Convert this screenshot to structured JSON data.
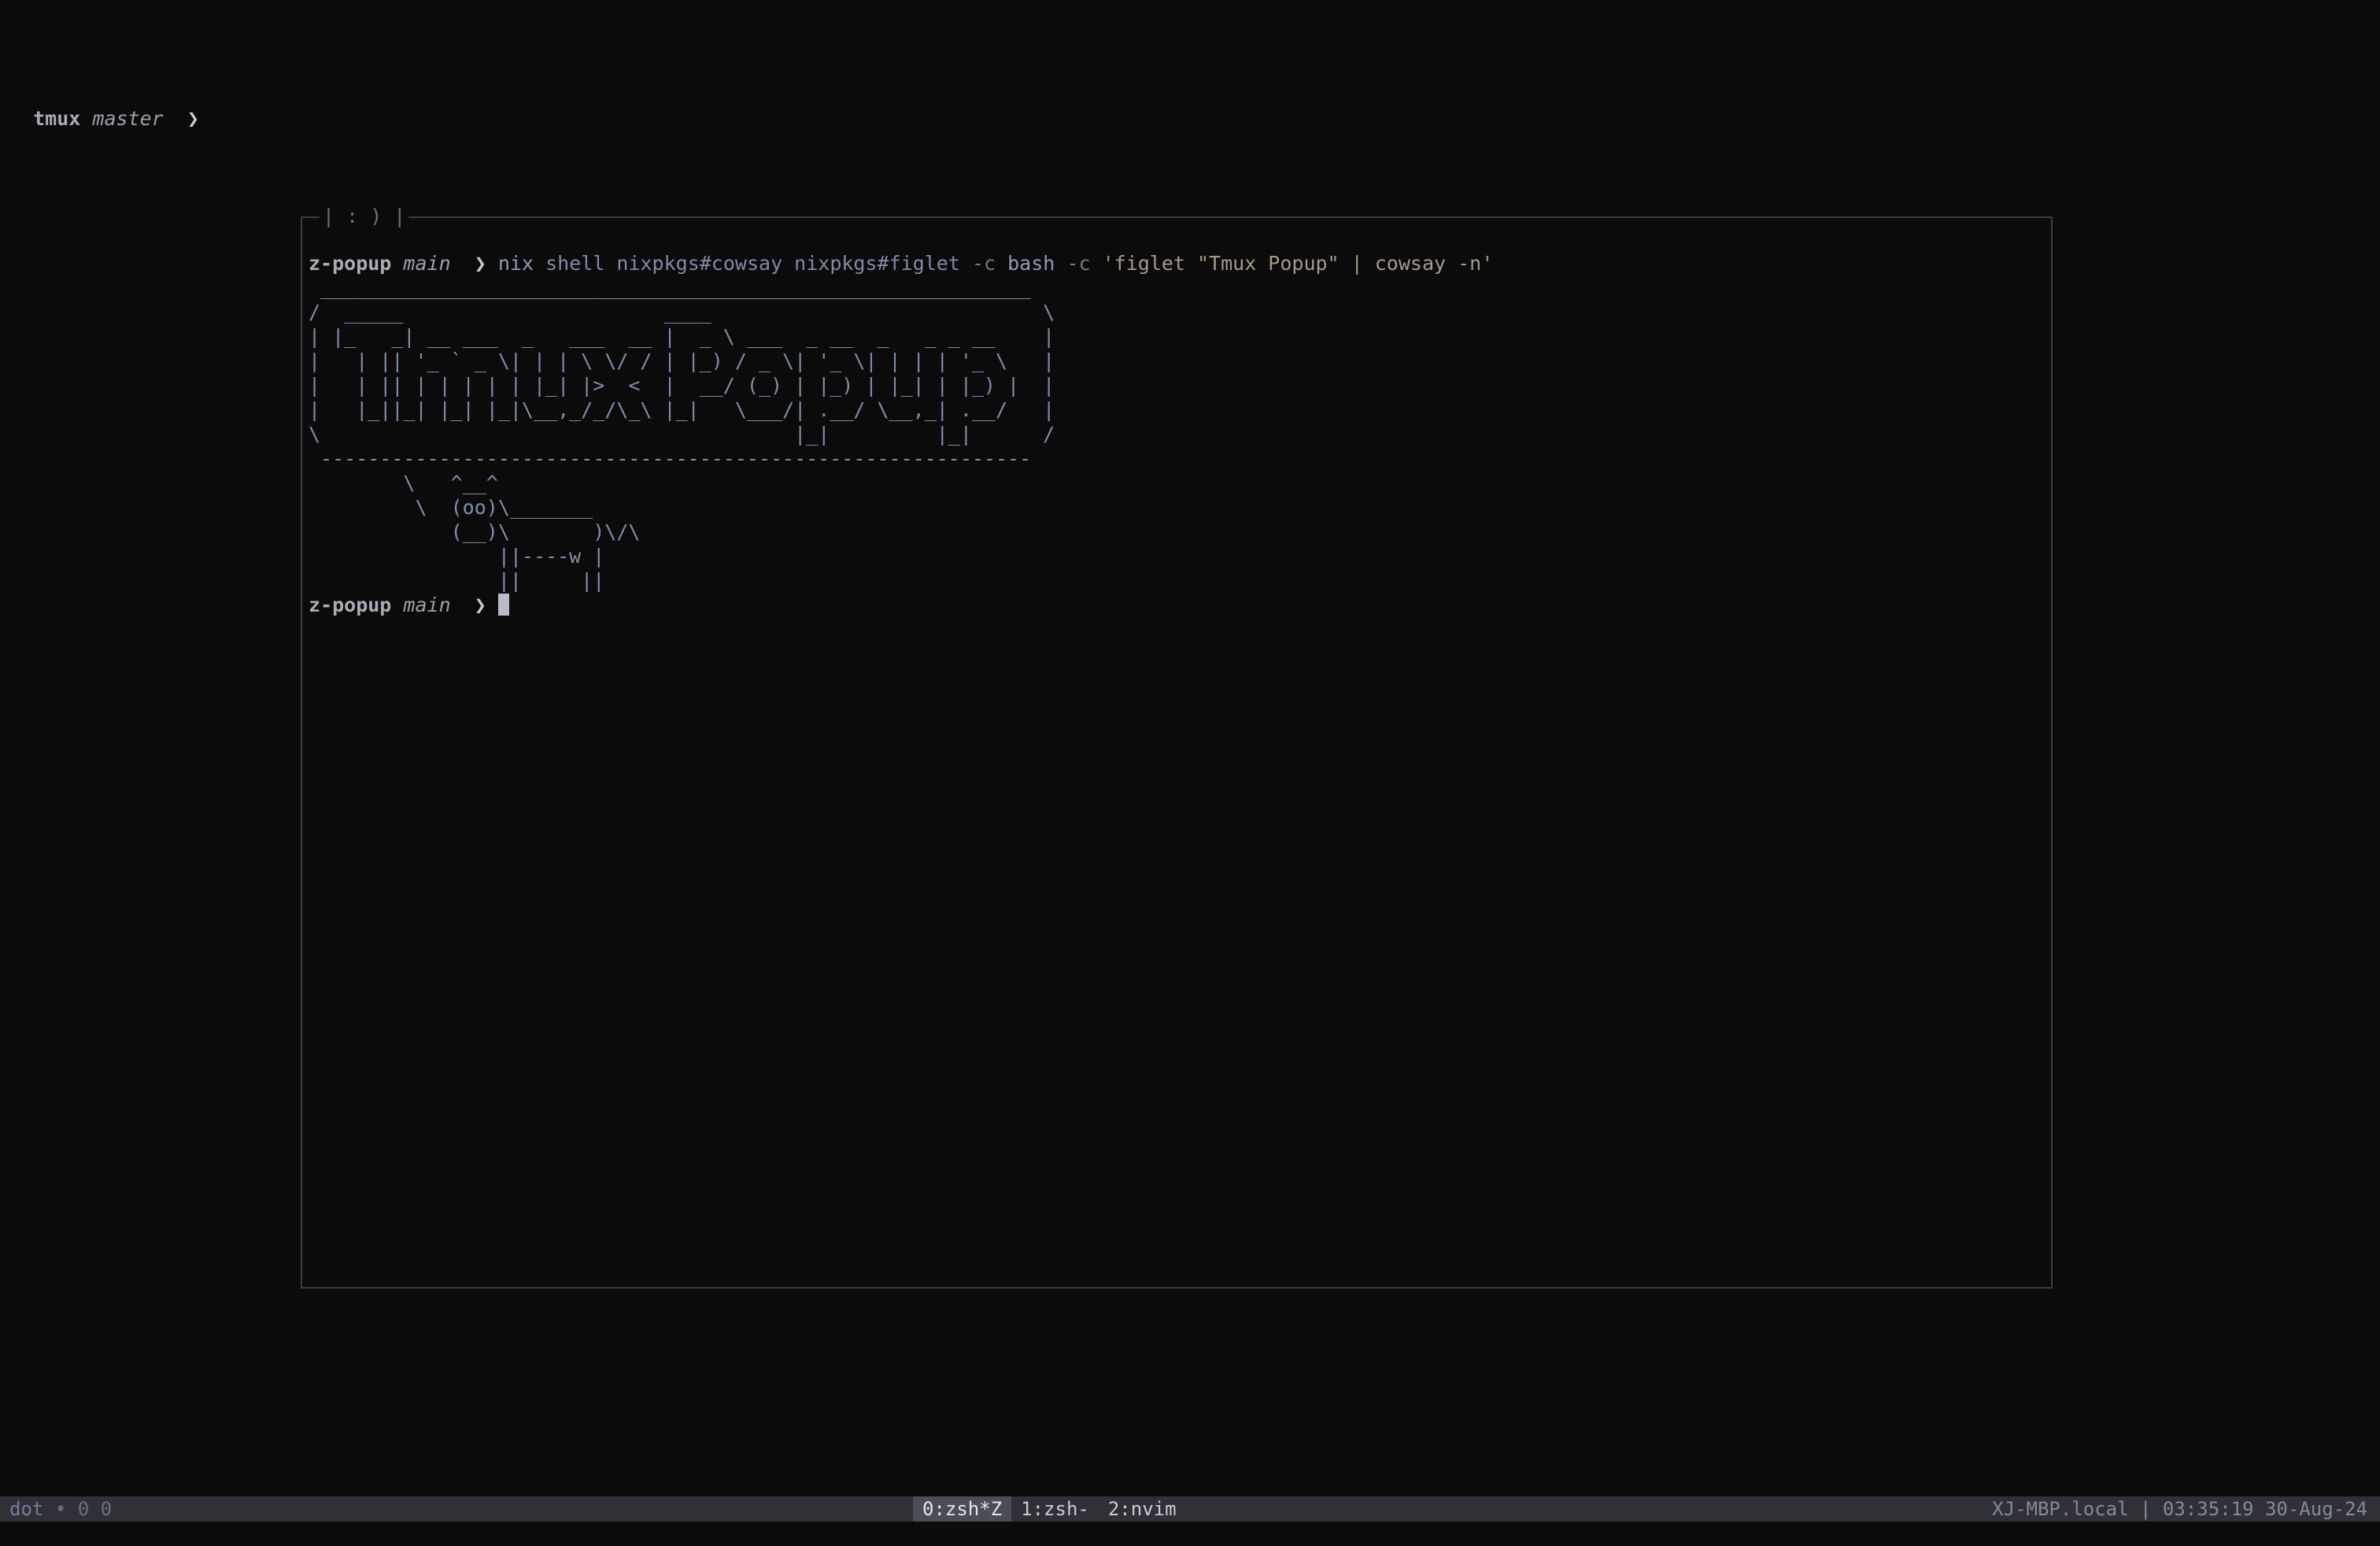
{
  "background_prompt": {
    "dir": "tmux",
    "branch": "master",
    "chevron": "❯"
  },
  "popup": {
    "title": "| : ) |",
    "prompt1": {
      "dir": "z-popup",
      "branch": "main",
      "chevron": "❯"
    },
    "command": {
      "nix": "nix",
      "args": "shell nixpkgs#cowsay nixpkgs#figlet",
      "flag1": "-c",
      "bash": "bash",
      "flag2": "-c",
      "string": "'figlet \"Tmux Popup\" | cowsay -n'"
    },
    "cowsay_output": " ____________________________________________________________\n/  _____                      ____                            \\\n| |_   _| __ ___  _   ___  __ |  _ \\ ___  _ __  _   _ _ __    |\n|   | || '_ ` _ \\| | | \\ \\/ / | |_) / _ \\| '_ \\| | | | '_ \\   |\n|   | || | | | | | |_| |>  <  |  __/ (_) | |_) | |_| | |_) |  |\n|   |_||_| |_| |_|\\__,_/_/\\_\\ |_|   \\___/| .__/ \\__,_| .__/   |\n\\                                        |_|         |_|      /\n ------------------------------------------------------------\n        \\   ^__^\n         \\  (oo)\\_______\n            (__)\\       )\\/\\\n                ||----w |\n                ||     ||",
    "prompt2": {
      "dir": "z-popup",
      "branch": "main",
      "chevron": "❯"
    }
  },
  "statusbar": {
    "session": "dot",
    "dot": "•",
    "counts": "0 0",
    "windows": [
      {
        "label": "0:zsh*Z",
        "active": true
      },
      {
        "label": "1:zsh-",
        "active": false
      },
      {
        "label": "2:nvim",
        "active": false
      }
    ],
    "right": "XJ-MBP.local | 03:35:19 30-Aug-24"
  },
  "colors": {
    "background": "#0b0b0b",
    "statusbar": "#2f3136",
    "popup_border": "#3a3d42",
    "ascii_art": "#7f8eae"
  }
}
